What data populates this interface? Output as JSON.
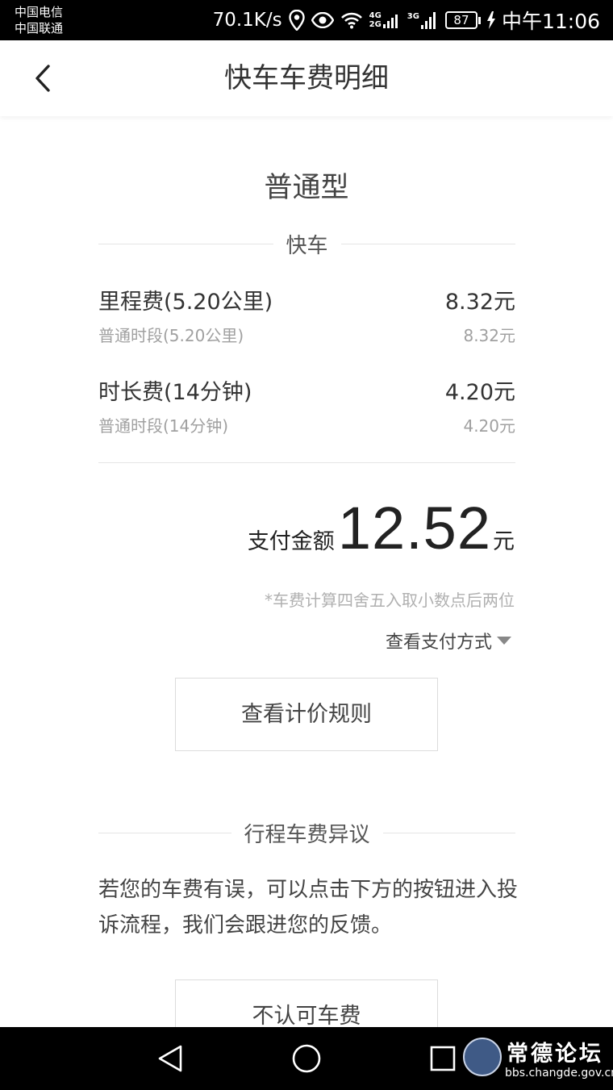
{
  "status_bar": {
    "carrier1": "中国电信",
    "carrier2": "中国联通",
    "speed": "70.1K/s",
    "net1": "4G",
    "net1b": "2G",
    "net2": "3G",
    "battery": "87",
    "time": "中午11:06"
  },
  "header": {
    "title": "快车车费明细"
  },
  "car_type": "普通型",
  "section_service": "快车",
  "fees": [
    {
      "label": "里程费(5.20公里)",
      "amount": "8.32元",
      "sub_label": "普通时段(5.20公里)",
      "sub_amount": "8.32元"
    },
    {
      "label": "时长费(14分钟)",
      "amount": "4.20元",
      "sub_label": "普通时段(14分钟)",
      "sub_amount": "4.20元"
    }
  ],
  "payment": {
    "label": "支付金额",
    "amount": "12.52",
    "unit": "元"
  },
  "rounding_note": "*车费计算四舍五入取小数点后两位",
  "payment_method_link": "查看支付方式",
  "pricing_rules_button": "查看计价规则",
  "dispute": {
    "title": "行程车费异议",
    "description": "若您的车费有误，可以点击下方的按钮进入投诉流程，我们会跟进您的反馈。",
    "button": "不认可车费"
  },
  "watermark": {
    "title": "常德论坛",
    "url": "bbs.changde.gov.cn"
  },
  "colors": {
    "accent_text": "#333333",
    "muted_text": "#a0a0a0",
    "divider": "#e5e5e5"
  }
}
